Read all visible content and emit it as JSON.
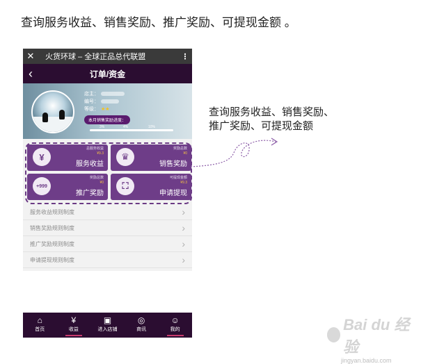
{
  "heading": "查询服务收益、销售奖励、推广奖励、可提现金额 。",
  "app": {
    "close_icon": "close-icon",
    "title": "火货环球 – 全球正品总代联盟",
    "menu_label": "⋮"
  },
  "nav": {
    "back": "‹",
    "title": "订单/资金"
  },
  "profile": {
    "store_label": "店主：",
    "id_label": "编号：",
    "level_label": "等级：",
    "stars": "★★",
    "progress_label": "本月销售奖励进度：",
    "progress_ticks": [
      "3%",
      "4%",
      "10%"
    ],
    "progress_value": 0
  },
  "tiles": [
    {
      "icon": "¥",
      "small": "总服务收益",
      "amount": "¥9.3",
      "label": "服务收益"
    },
    {
      "icon": "♛",
      "small": "奖励总数",
      "amount": "¥0",
      "label": "销售奖励"
    },
    {
      "icon": "+999",
      "small": "奖励总数",
      "amount": "¥0",
      "label": "推广奖励"
    },
    {
      "icon": "⛶",
      "small": "可提现金额",
      "amount": "¥9.3",
      "label": "申请提现"
    }
  ],
  "rules": [
    "服务收益规则制度",
    "销售奖励规则制度",
    "推广奖励规则制度",
    "申请提现规则制度"
  ],
  "bottom_nav": [
    {
      "icon": "⌂",
      "label": "首页",
      "active": false
    },
    {
      "icon": "¥",
      "label": "收益",
      "active": true
    },
    {
      "icon": "▣",
      "label": "进入店铺",
      "active": false
    },
    {
      "icon": "◎",
      "label": "商讯",
      "active": false
    },
    {
      "icon": "☺",
      "label": "我的",
      "active": true
    }
  ],
  "annotation": {
    "line1": "查询服务收益、销售奖励、",
    "line2": "推广奖励、可提现金额"
  },
  "watermark": {
    "logo": "Bai du 经验",
    "url": "jingyan.baidu.com"
  },
  "colors": {
    "accent": "#6e3d88",
    "nav_dark": "#2b0d31",
    "amount": "#f5c242",
    "active_bar": "#c83a6c"
  }
}
